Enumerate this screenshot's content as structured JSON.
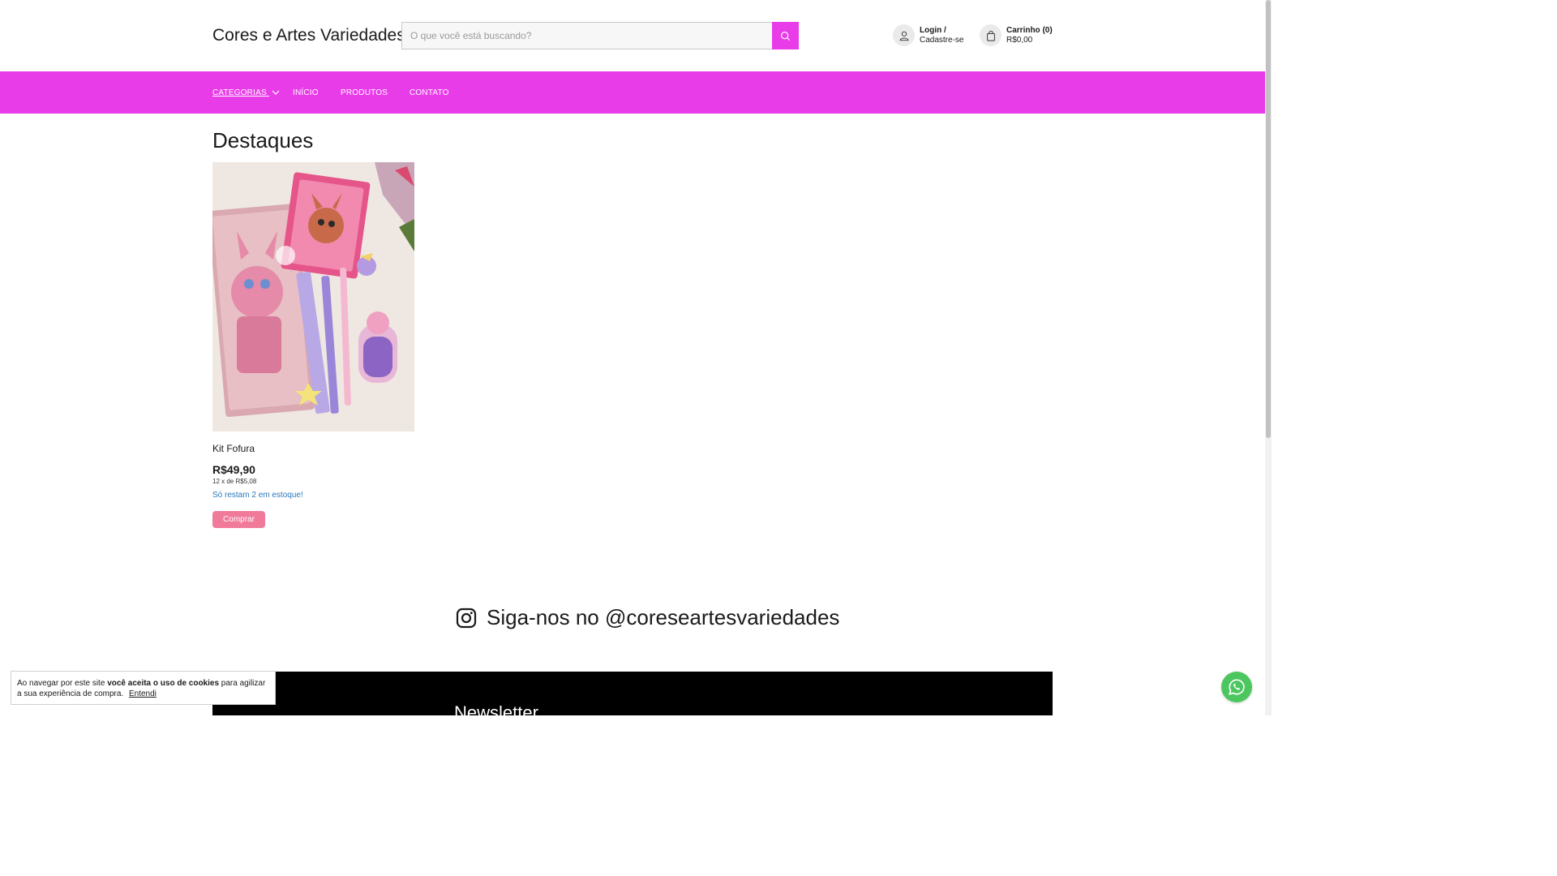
{
  "header": {
    "brand": "Cores e Artes Variedades",
    "search_placeholder": "O que você está buscando?",
    "account": {
      "line1": "Login /",
      "line2": "Cadastre-se",
      "icon": "user-icon"
    },
    "cart": {
      "line1": "Carrinho (0)",
      "line2": "R$0,00",
      "icon": "shopping-bag-icon"
    }
  },
  "nav": {
    "items": [
      "CATEGORIAS",
      "INÍCIO",
      "PRODUTOS",
      "CONTATO"
    ]
  },
  "main": {
    "section_title": "Destaques",
    "product": {
      "name": "Kit Fofura",
      "price": "R$49,90",
      "installments": "12 x de R$5,08",
      "stock": "Só restam 2 em estoque!",
      "buy_label": "Comprar"
    },
    "instagram": {
      "text": "Siga-nos no @coreseartesvariedades",
      "icon": "instagram-icon"
    }
  },
  "footer": {
    "newsletter_title": "Newsletter"
  },
  "cookie": {
    "text_before": "Ao navegar por este site ",
    "text_bold": "você aceita o uso de cookies",
    "text_after": " para agilizar a sua experiência de compra.",
    "accept": "Entendi"
  },
  "colors": {
    "accent": "#e93ce9",
    "buy_button": "#f07a9a",
    "stock_text": "#2b78b8",
    "whatsapp": "#4cc65f"
  }
}
